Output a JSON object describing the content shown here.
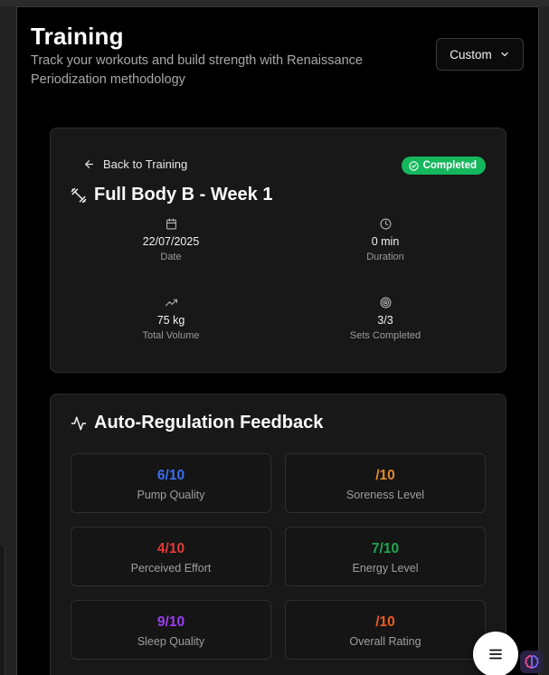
{
  "header": {
    "title": "Training",
    "subtitle": "Track your workouts and build strength with Renaissance Periodization methodology",
    "mode_button_label": "Custom"
  },
  "workout": {
    "back_label": "Back to Training",
    "status_badge": "Completed",
    "title": "Full Body B - Week 1",
    "stats": [
      {
        "icon": "calendar-icon",
        "value": "22/07/2025",
        "label": "Date"
      },
      {
        "icon": "clock-icon",
        "value": "0 min",
        "label": "Duration"
      },
      {
        "icon": "trending-up-icon",
        "value": "75 kg",
        "label": "Total Volume"
      },
      {
        "icon": "target-icon",
        "value": "3/3",
        "label": "Sets Completed"
      }
    ]
  },
  "feedback": {
    "title": "Auto-Regulation Feedback",
    "items": [
      {
        "value": "6/10",
        "label": "Pump Quality",
        "color": "#3b6ef0"
      },
      {
        "value": "/10",
        "label": "Soreness Level",
        "color": "#e08a2c"
      },
      {
        "value": "4/10",
        "label": "Perceived Effort",
        "color": "#e03a3a"
      },
      {
        "value": "7/10",
        "label": "Energy Level",
        "color": "#1fa653"
      },
      {
        "value": "9/10",
        "label": "Sleep Quality",
        "color": "#9a3ff0"
      },
      {
        "value": "/10",
        "label": "Overall Rating",
        "color": "#ee5a24"
      }
    ]
  },
  "colors": {
    "accent_green": "#15b75c",
    "background": "#000000",
    "card": "#181818"
  }
}
